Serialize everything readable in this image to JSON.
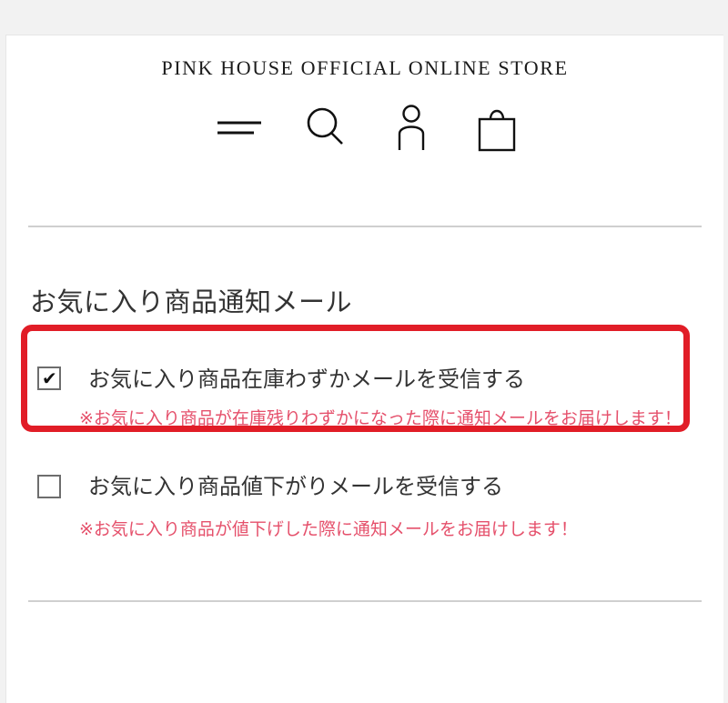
{
  "header": {
    "store_title": "PINK HOUSE OFFICIAL ONLINE STORE"
  },
  "nav_icons": [
    "menu-icon",
    "search-icon",
    "account-icon",
    "cart-icon"
  ],
  "section": {
    "title": "お気に入り商品通知メール"
  },
  "options": [
    {
      "label": "お気に入り商品在庫わずかメールを受信する",
      "checked": true,
      "checkmark": "✔",
      "note": "※お気に入り商品が在庫残りわずかになった際に通知メールをお届けします！"
    },
    {
      "label": "お気に入り商品値下がりメールを受信する",
      "checked": false,
      "checkmark": "",
      "note": "※お気に入り商品が値下げした際に通知メールをお届けします！"
    }
  ],
  "colors": {
    "accent_note": "#e5506b",
    "highlight_border": "#e11d27",
    "text": "#333333",
    "divider": "#cfcfcf"
  }
}
